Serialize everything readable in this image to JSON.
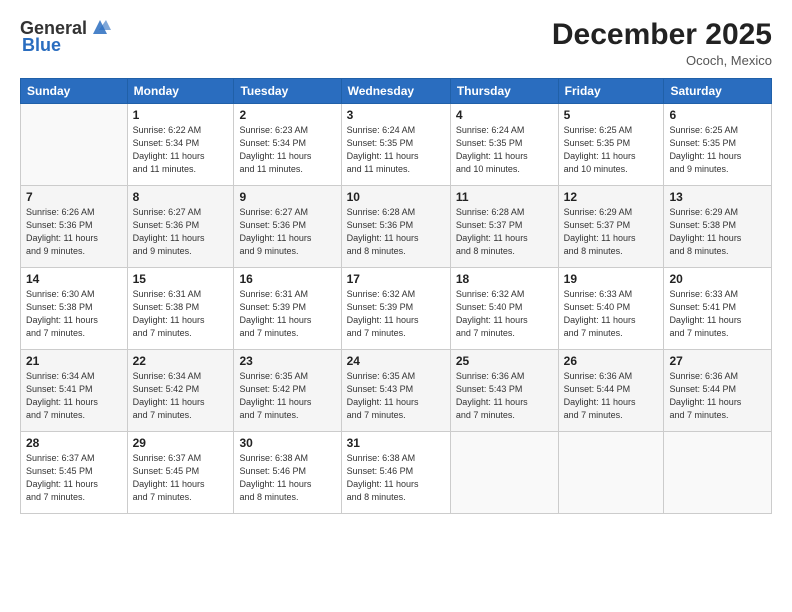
{
  "header": {
    "logo_general": "General",
    "logo_blue": "Blue",
    "month_year": "December 2025",
    "location": "Ococh, Mexico"
  },
  "days_of_week": [
    "Sunday",
    "Monday",
    "Tuesday",
    "Wednesday",
    "Thursday",
    "Friday",
    "Saturday"
  ],
  "weeks": [
    [
      {
        "day": "",
        "info": ""
      },
      {
        "day": "1",
        "info": "Sunrise: 6:22 AM\nSunset: 5:34 PM\nDaylight: 11 hours\nand 11 minutes."
      },
      {
        "day": "2",
        "info": "Sunrise: 6:23 AM\nSunset: 5:34 PM\nDaylight: 11 hours\nand 11 minutes."
      },
      {
        "day": "3",
        "info": "Sunrise: 6:24 AM\nSunset: 5:35 PM\nDaylight: 11 hours\nand 11 minutes."
      },
      {
        "day": "4",
        "info": "Sunrise: 6:24 AM\nSunset: 5:35 PM\nDaylight: 11 hours\nand 10 minutes."
      },
      {
        "day": "5",
        "info": "Sunrise: 6:25 AM\nSunset: 5:35 PM\nDaylight: 11 hours\nand 10 minutes."
      },
      {
        "day": "6",
        "info": "Sunrise: 6:25 AM\nSunset: 5:35 PM\nDaylight: 11 hours\nand 9 minutes."
      }
    ],
    [
      {
        "day": "7",
        "info": "Sunrise: 6:26 AM\nSunset: 5:36 PM\nDaylight: 11 hours\nand 9 minutes."
      },
      {
        "day": "8",
        "info": "Sunrise: 6:27 AM\nSunset: 5:36 PM\nDaylight: 11 hours\nand 9 minutes."
      },
      {
        "day": "9",
        "info": "Sunrise: 6:27 AM\nSunset: 5:36 PM\nDaylight: 11 hours\nand 9 minutes."
      },
      {
        "day": "10",
        "info": "Sunrise: 6:28 AM\nSunset: 5:36 PM\nDaylight: 11 hours\nand 8 minutes."
      },
      {
        "day": "11",
        "info": "Sunrise: 6:28 AM\nSunset: 5:37 PM\nDaylight: 11 hours\nand 8 minutes."
      },
      {
        "day": "12",
        "info": "Sunrise: 6:29 AM\nSunset: 5:37 PM\nDaylight: 11 hours\nand 8 minutes."
      },
      {
        "day": "13",
        "info": "Sunrise: 6:29 AM\nSunset: 5:38 PM\nDaylight: 11 hours\nand 8 minutes."
      }
    ],
    [
      {
        "day": "14",
        "info": "Sunrise: 6:30 AM\nSunset: 5:38 PM\nDaylight: 11 hours\nand 7 minutes."
      },
      {
        "day": "15",
        "info": "Sunrise: 6:31 AM\nSunset: 5:38 PM\nDaylight: 11 hours\nand 7 minutes."
      },
      {
        "day": "16",
        "info": "Sunrise: 6:31 AM\nSunset: 5:39 PM\nDaylight: 11 hours\nand 7 minutes."
      },
      {
        "day": "17",
        "info": "Sunrise: 6:32 AM\nSunset: 5:39 PM\nDaylight: 11 hours\nand 7 minutes."
      },
      {
        "day": "18",
        "info": "Sunrise: 6:32 AM\nSunset: 5:40 PM\nDaylight: 11 hours\nand 7 minutes."
      },
      {
        "day": "19",
        "info": "Sunrise: 6:33 AM\nSunset: 5:40 PM\nDaylight: 11 hours\nand 7 minutes."
      },
      {
        "day": "20",
        "info": "Sunrise: 6:33 AM\nSunset: 5:41 PM\nDaylight: 11 hours\nand 7 minutes."
      }
    ],
    [
      {
        "day": "21",
        "info": "Sunrise: 6:34 AM\nSunset: 5:41 PM\nDaylight: 11 hours\nand 7 minutes."
      },
      {
        "day": "22",
        "info": "Sunrise: 6:34 AM\nSunset: 5:42 PM\nDaylight: 11 hours\nand 7 minutes."
      },
      {
        "day": "23",
        "info": "Sunrise: 6:35 AM\nSunset: 5:42 PM\nDaylight: 11 hours\nand 7 minutes."
      },
      {
        "day": "24",
        "info": "Sunrise: 6:35 AM\nSunset: 5:43 PM\nDaylight: 11 hours\nand 7 minutes."
      },
      {
        "day": "25",
        "info": "Sunrise: 6:36 AM\nSunset: 5:43 PM\nDaylight: 11 hours\nand 7 minutes."
      },
      {
        "day": "26",
        "info": "Sunrise: 6:36 AM\nSunset: 5:44 PM\nDaylight: 11 hours\nand 7 minutes."
      },
      {
        "day": "27",
        "info": "Sunrise: 6:36 AM\nSunset: 5:44 PM\nDaylight: 11 hours\nand 7 minutes."
      }
    ],
    [
      {
        "day": "28",
        "info": "Sunrise: 6:37 AM\nSunset: 5:45 PM\nDaylight: 11 hours\nand 7 minutes."
      },
      {
        "day": "29",
        "info": "Sunrise: 6:37 AM\nSunset: 5:45 PM\nDaylight: 11 hours\nand 7 minutes."
      },
      {
        "day": "30",
        "info": "Sunrise: 6:38 AM\nSunset: 5:46 PM\nDaylight: 11 hours\nand 8 minutes."
      },
      {
        "day": "31",
        "info": "Sunrise: 6:38 AM\nSunset: 5:46 PM\nDaylight: 11 hours\nand 8 minutes."
      },
      {
        "day": "",
        "info": ""
      },
      {
        "day": "",
        "info": ""
      },
      {
        "day": "",
        "info": ""
      }
    ]
  ]
}
